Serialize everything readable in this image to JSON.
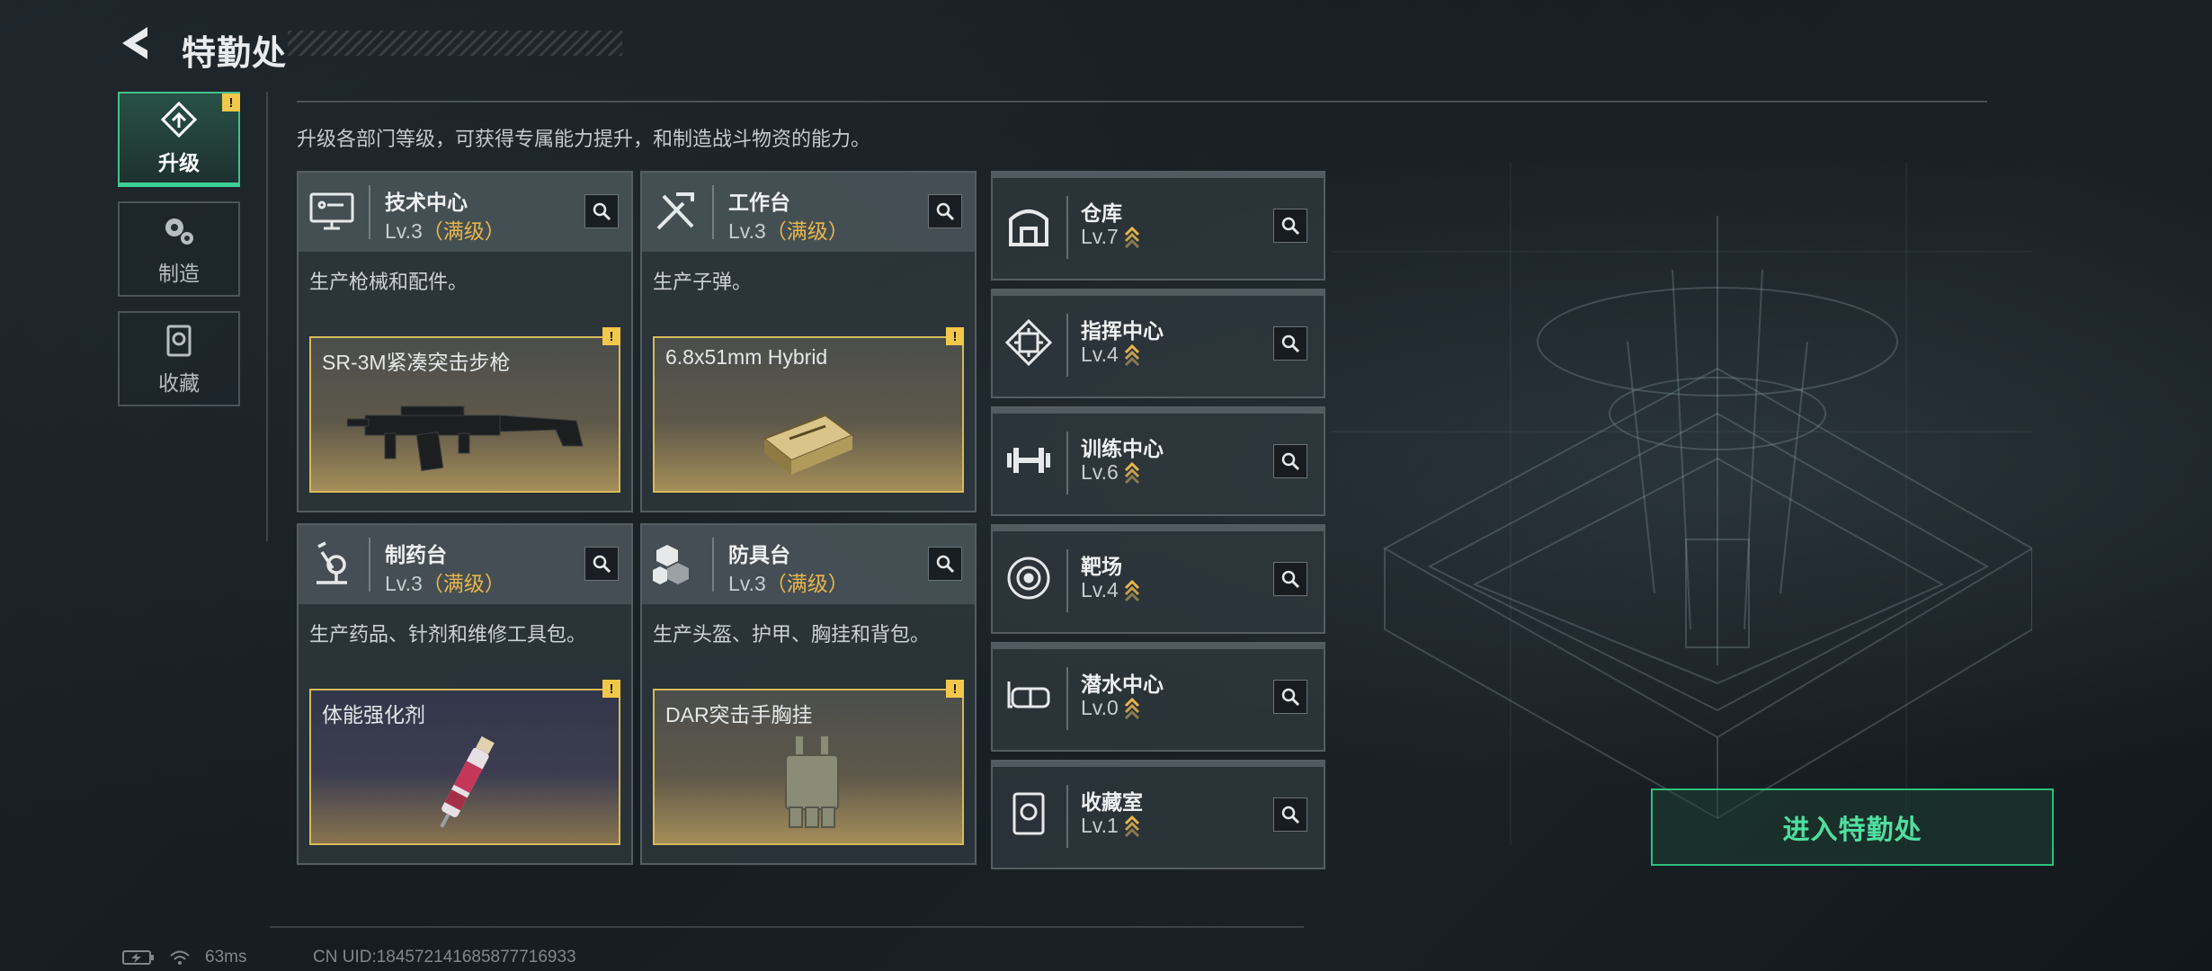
{
  "header": {
    "title": "特勤处",
    "back_label": "back"
  },
  "nav": {
    "tabs": [
      {
        "label": "升级",
        "icon": "upgrade-icon",
        "active": true,
        "alert": "!"
      },
      {
        "label": "制造",
        "icon": "gears-icon",
        "active": false
      },
      {
        "label": "收藏",
        "icon": "collection-icon",
        "active": false
      }
    ]
  },
  "intro": "升级各部门等级，可获得专属能力提升，和制造战斗物资的能力。",
  "big_cards": [
    {
      "name": "技术中心",
      "level": "Lv.3",
      "max": "（满级）",
      "desc": "生产枪械和配件。",
      "product": "SR-3M紧凑突击步枪",
      "alert": "!",
      "icon": "computer-icon"
    },
    {
      "name": "工作台",
      "level": "Lv.3",
      "max": "（满级）",
      "desc": "生产子弹。",
      "product": "6.8x51mm Hybrid",
      "alert": "!",
      "icon": "tools-icon"
    },
    {
      "name": "制药台",
      "level": "Lv.3",
      "max": "（满级）",
      "desc": "生产药品、针剂和维修工具包。",
      "product": "体能强化剂",
      "alert": "!",
      "icon": "microscope-icon"
    },
    {
      "name": "防具台",
      "level": "Lv.3",
      "max": "（满级）",
      "desc": "生产头盔、护甲、胸挂和背包。",
      "product": "DAR突击手胸挂",
      "alert": "!",
      "icon": "armor-icon"
    }
  ],
  "small_cards": [
    {
      "name": "仓库",
      "level": "Lv.7",
      "icon": "warehouse-icon"
    },
    {
      "name": "指挥中心",
      "level": "Lv.4",
      "icon": "command-chip-icon"
    },
    {
      "name": "训练中心",
      "level": "Lv.6",
      "icon": "dumbbell-icon"
    },
    {
      "name": "靶场",
      "level": "Lv.4",
      "icon": "target-icon"
    },
    {
      "name": "潜水中心",
      "level": "Lv.0",
      "icon": "diving-mask-icon"
    },
    {
      "name": "收藏室",
      "level": "Lv.1",
      "icon": "display-case-icon"
    }
  ],
  "enter_button": "进入特勤处",
  "status": {
    "ping": "63ms",
    "uid": "CN UID:184572141685877716933"
  },
  "colors": {
    "accent": "#3ed09a",
    "max_level": "#e8b64a",
    "warning": "#f2c84a"
  }
}
